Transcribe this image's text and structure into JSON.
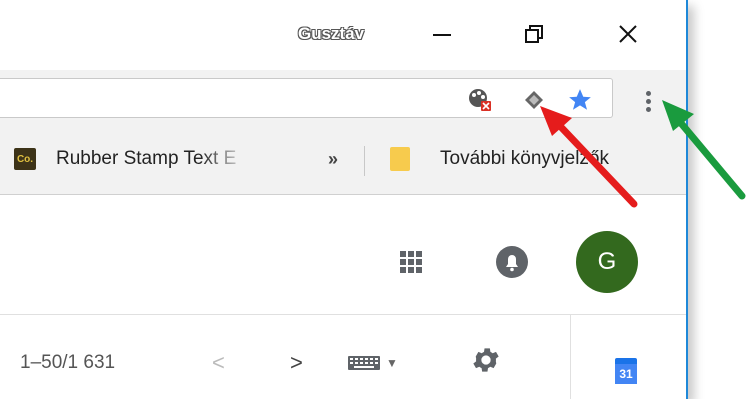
{
  "titlebar": {
    "profile_name": "Gusztáv"
  },
  "toolbar": {
    "extensions": [
      "palette-blocked-icon",
      "diamond-extension-icon",
      "bookmark-star-icon"
    ],
    "menu_icon": "more-vert-icon"
  },
  "bookmarks": {
    "items": [
      {
        "icon": "Co.",
        "label": "Rubber Stamp Text E"
      }
    ],
    "overflow": "»",
    "other_folder": "További könyvjelzők"
  },
  "account": {
    "avatar_letter": "G"
  },
  "mail": {
    "pager": "1–50/1 631",
    "prev": "<",
    "next": ">",
    "calendar_day": "31"
  },
  "colors": {
    "accent_blue": "#1e88d8",
    "avatar_green": "#33691e",
    "arrow_red": "#e51c1c",
    "arrow_green": "#1a9b3e",
    "star_blue": "#4285f4"
  }
}
